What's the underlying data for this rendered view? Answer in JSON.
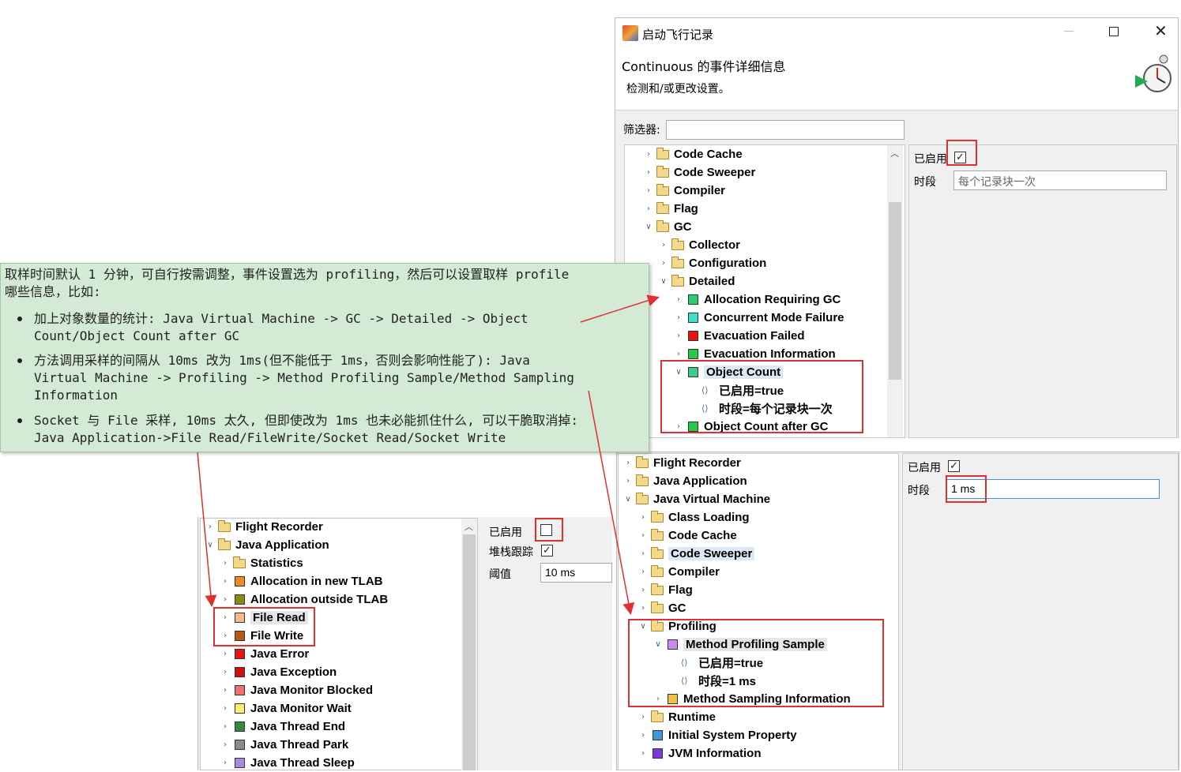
{
  "dialog": {
    "title": "启动飞行记录",
    "header_title": "Continuous 的事件详细信息",
    "header_subtitle": "检测和/或更改设置。",
    "filter_label": "筛选器:",
    "filter_value": "",
    "window_controls": [
      "minimize-icon",
      "maximize-icon",
      "close-icon"
    ]
  },
  "top_tree": {
    "items": [
      {
        "label": "Code Cache",
        "type": "folder"
      },
      {
        "label": "Code Sweeper",
        "type": "folder"
      },
      {
        "label": "Compiler",
        "type": "folder"
      },
      {
        "label": "Flag",
        "type": "folder"
      },
      {
        "label": "GC",
        "type": "folder",
        "expanded": true
      },
      {
        "label": "Collector",
        "type": "folder"
      },
      {
        "label": "Configuration",
        "type": "folder"
      },
      {
        "label": "Detailed",
        "type": "folder",
        "expanded": true
      },
      {
        "label": "Allocation Requiring GC",
        "type": "event",
        "color": "#2ecc71"
      },
      {
        "label": "Concurrent Mode Failure",
        "type": "event",
        "color": "#40e0d0"
      },
      {
        "label": "Evacuation Failed",
        "type": "event",
        "color": "#ee1111"
      },
      {
        "label": "Evacuation Information",
        "type": "event",
        "color": "#22cc44"
      },
      {
        "label": "Object Count",
        "type": "event",
        "color": "#3dcc8a",
        "expanded": true
      },
      {
        "label": "已启用=true",
        "type": "prop"
      },
      {
        "label": "时段=每个记录块一次",
        "type": "prop"
      },
      {
        "label": "Object Count after GC",
        "type": "event",
        "color": "#22cc44"
      }
    ]
  },
  "top_settings": {
    "enabled_label": "已启用",
    "enabled_checked": "✓",
    "period_label": "时段",
    "period_value": "每个记录块一次"
  },
  "note": {
    "line1": "取样时间默认 1 分钟，可自行按需调整，事件设置选为 profiling，然后可以设置取样 profile",
    "line2": "哪些信息，比如:",
    "bullet1_l1": "加上对象数量的统计: Java Virtual Machine -> GC -> Detailed -> Object",
    "bullet1_l2": "Count/Object Count after GC",
    "bullet2_l1": "方法调用采样的间隔从 10ms 改为 1ms(但不能低于 1ms，否则会影响性能了): Java",
    "bullet2_l2": "Virtual Machine -> Profiling -> Method Profiling Sample/Method Sampling",
    "bullet2_l3": "Information",
    "bullet3_l1": "Socket 与 File 采样, 10ms 太久, 但即使改为 1ms 也未必能抓住什么, 可以干脆取消掉:",
    "bullet3_l2": "Java Application->File Read/FileWrite/Socket Read/Socket Write"
  },
  "left_tree": {
    "items": [
      {
        "label": "Flight Recorder",
        "type": "folder"
      },
      {
        "label": "Java Application",
        "type": "folder",
        "expanded": true
      },
      {
        "label": "Statistics",
        "type": "folder"
      },
      {
        "label": "Allocation in new TLAB",
        "type": "event",
        "color": "#f08a24"
      },
      {
        "label": "Allocation outside TLAB",
        "type": "event",
        "color": "#8a8a10"
      },
      {
        "label": "File Read",
        "type": "event",
        "color": "#f5b98a"
      },
      {
        "label": "File Write",
        "type": "event",
        "color": "#b55a10"
      },
      {
        "label": "Java Error",
        "type": "event",
        "color": "#ee1111"
      },
      {
        "label": "Java Exception",
        "type": "event",
        "color": "#cc1111"
      },
      {
        "label": "Java Monitor Blocked",
        "type": "event",
        "color": "#f07070"
      },
      {
        "label": "Java Monitor Wait",
        "type": "event",
        "color": "#f8ee70"
      },
      {
        "label": "Java Thread End",
        "type": "event",
        "color": "#2e8b3e"
      },
      {
        "label": "Java Thread Park",
        "type": "event",
        "color": "#8a8a8a"
      },
      {
        "label": "Java Thread Sleep",
        "type": "event",
        "color": "#a98ae0"
      }
    ]
  },
  "left_settings": {
    "enabled_label": "已启用",
    "stack_label": "堆栈跟踪",
    "stack_checked": "✓",
    "threshold_label": "阈值",
    "threshold_value": "10 ms"
  },
  "right_tree": {
    "items": [
      {
        "label": "Flight Recorder",
        "type": "folder"
      },
      {
        "label": "Java Application",
        "type": "folder"
      },
      {
        "label": "Java Virtual Machine",
        "type": "folder",
        "expanded": true
      },
      {
        "label": "Class Loading",
        "type": "folder"
      },
      {
        "label": "Code Cache",
        "type": "folder"
      },
      {
        "label": "Code Sweeper",
        "type": "folder"
      },
      {
        "label": "Compiler",
        "type": "folder"
      },
      {
        "label": "Flag",
        "type": "folder"
      },
      {
        "label": "GC",
        "type": "folder"
      },
      {
        "label": "Profiling",
        "type": "folder",
        "expanded": true
      },
      {
        "label": "Method Profiling Sample",
        "type": "event",
        "color": "#cc88ee",
        "expanded": true
      },
      {
        "label": "已启用=true",
        "type": "prop"
      },
      {
        "label": "时段=1 ms",
        "type": "prop"
      },
      {
        "label": "Method Sampling Information",
        "type": "event",
        "color": "#f0c040"
      },
      {
        "label": "Runtime",
        "type": "folder"
      },
      {
        "label": "Initial System Property",
        "type": "event",
        "color": "#3a9ad9"
      },
      {
        "label": "JVM Information",
        "type": "event",
        "color": "#7a3ad9"
      }
    ]
  },
  "right_settings": {
    "enabled_label": "已启用",
    "enabled_checked": "✓",
    "period_label": "时段",
    "period_value": "1 ms"
  }
}
